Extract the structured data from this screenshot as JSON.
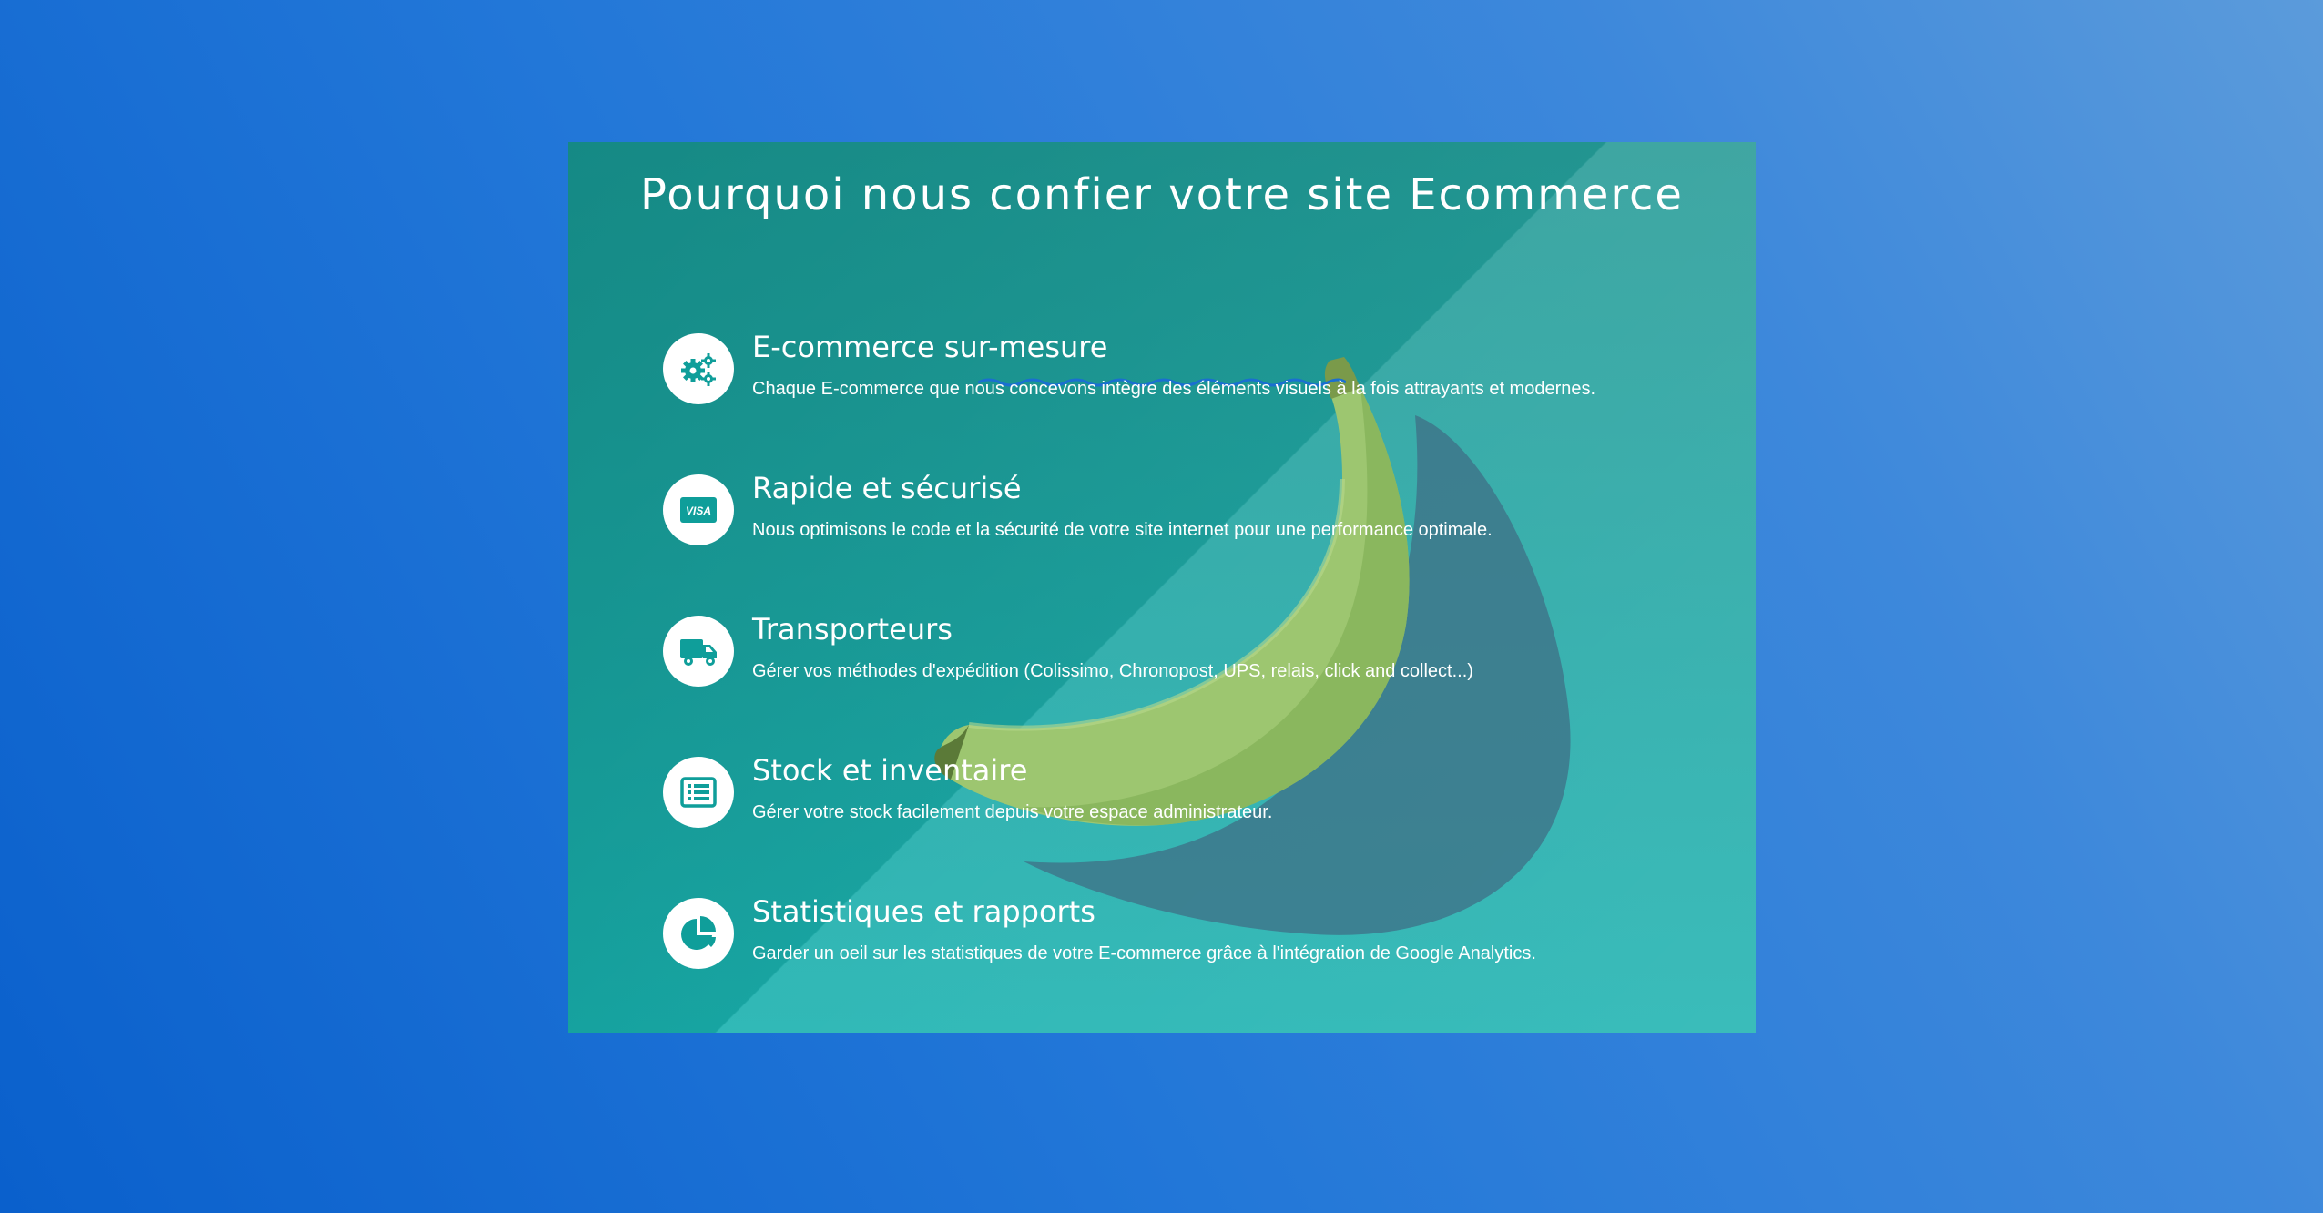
{
  "section": {
    "title": "Pourquoi nous confier votre site Ecommerce"
  },
  "colors": {
    "accent": "#0f9e9a",
    "wave": "#1a6fd0"
  },
  "features": [
    {
      "icon": "gears-icon",
      "title": "E-commerce sur-mesure",
      "desc": "Chaque E-commerce que nous concevons intègre des éléments visuels à la fois attrayants et modernes."
    },
    {
      "icon": "visa-card-icon",
      "icon_text": "VISA",
      "title": "Rapide et sécurisé",
      "desc": "Nous optimisons le code et la sécurité de votre site internet pour une performance optimale."
    },
    {
      "icon": "truck-icon",
      "title": "Transporteurs",
      "desc": "Gérer vos méthodes d'expédition (Colissimo, Chronopost, UPS, relais, click and collect...)"
    },
    {
      "icon": "list-icon",
      "title": "Stock et inventaire",
      "desc": "Gérer votre stock facilement depuis votre espace administrateur."
    },
    {
      "icon": "pie-chart-icon",
      "title": "Statistiques et rapports",
      "desc": "Garder un oeil sur les statistiques de votre E-commerce grâce à l'intégration de Google Analytics."
    }
  ]
}
